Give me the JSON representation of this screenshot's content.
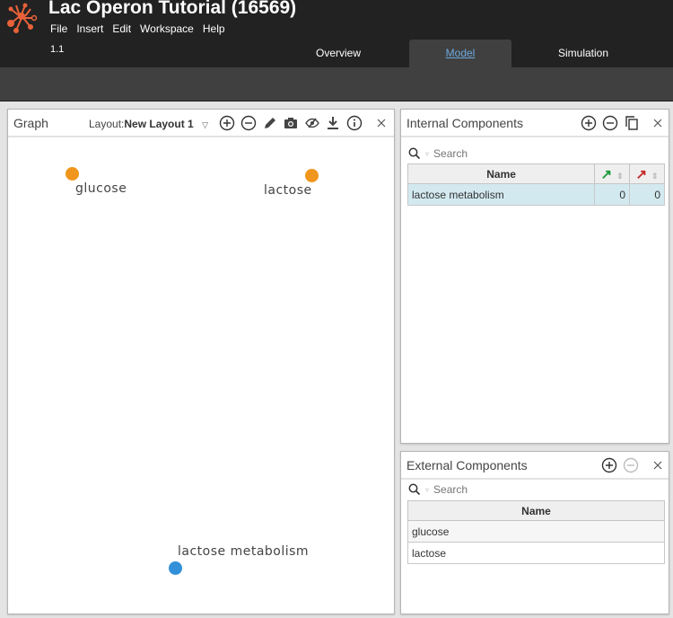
{
  "app": {
    "title": "Lac Operon Tutorial (16569)",
    "version": "1.1",
    "menu": [
      "File",
      "Insert",
      "Edit",
      "Workspace",
      "Help"
    ],
    "logo_icon": "network-logo-icon",
    "brand_color": "#e8613a"
  },
  "tabs": [
    {
      "label": "Overview",
      "active": false
    },
    {
      "label": "Model",
      "active": true
    },
    {
      "label": "Simulation",
      "active": false
    }
  ],
  "graph_panel": {
    "title": "Graph",
    "layout_prefix": "Layout:",
    "layout_value": "New Layout 1",
    "toolbar_icons": [
      "zoom-in-icon",
      "zoom-out-icon",
      "pencil-icon",
      "camera-icon",
      "hide-icon",
      "download-icon",
      "info-icon",
      "close-icon"
    ],
    "nodes": [
      {
        "label": "glucose",
        "type": "external",
        "color": "#f0961c"
      },
      {
        "label": "lactose",
        "type": "external",
        "color": "#f0961c"
      },
      {
        "label": "lactose metabolism",
        "type": "internal",
        "color": "#3190d8"
      }
    ]
  },
  "internal_components": {
    "title": "Internal Components",
    "search_placeholder": "Search",
    "columns": [
      "Name",
      "positive-regulators-icon",
      "negative-regulators-icon"
    ],
    "rows": [
      {
        "name": "lactose metabolism",
        "positive": "0",
        "negative": "0",
        "selected": true
      }
    ]
  },
  "external_components": {
    "title": "External Components",
    "search_placeholder": "Search",
    "columns": [
      "Name"
    ],
    "rows": [
      {
        "name": "glucose"
      },
      {
        "name": "lactose"
      }
    ]
  }
}
